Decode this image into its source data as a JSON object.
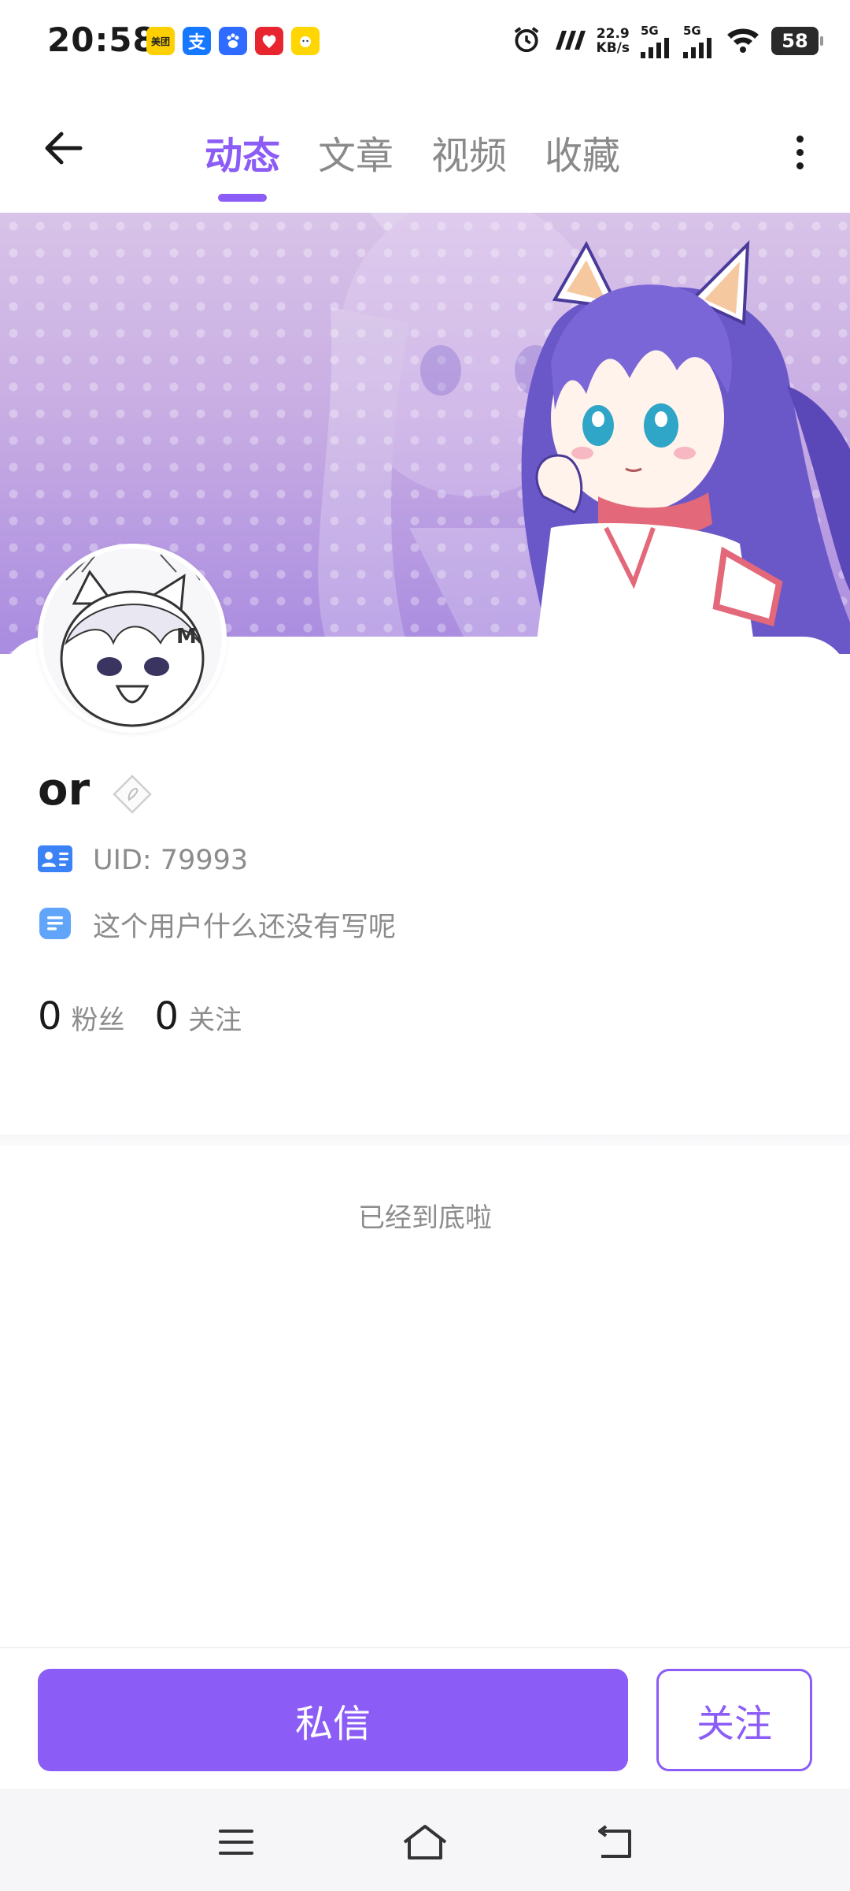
{
  "status_bar": {
    "time": "20:58",
    "app_icons": [
      {
        "name": "meituan-icon",
        "label": "美团",
        "color": "#ffd000"
      },
      {
        "name": "alipay-icon",
        "label": "支",
        "color": "#1677ff"
      },
      {
        "name": "baidu-icon",
        "label": "",
        "color": "#2f6bff"
      },
      {
        "name": "heart-app-icon",
        "label": "",
        "color": "#e8242f"
      },
      {
        "name": "yellow-app-icon",
        "label": "",
        "color": "#ffd600"
      }
    ],
    "net_speed_value": "22.9",
    "net_speed_unit": "KB/s",
    "sim1_label": "5G",
    "sim2_label": "5G",
    "battery": "58"
  },
  "nav": {
    "tabs": [
      {
        "label": "动态",
        "active": true
      },
      {
        "label": "文章",
        "active": false
      },
      {
        "label": "视频",
        "active": false
      },
      {
        "label": "收藏",
        "active": false
      }
    ]
  },
  "profile": {
    "username": "or",
    "uid": "UID: 79993",
    "bio": "这个用户什么还没有写呢",
    "fans_count": "0",
    "fans_label": "粉丝",
    "following_count": "0",
    "following_label": "关注"
  },
  "feed": {
    "end_text": "已经到底啦"
  },
  "actions": {
    "message_label": "私信",
    "follow_label": "关注"
  },
  "colors": {
    "accent": "#8b5cf6",
    "muted_text": "#8c8c8c",
    "id_icon": "#3b82f6",
    "bio_icon": "#60a5fa"
  }
}
